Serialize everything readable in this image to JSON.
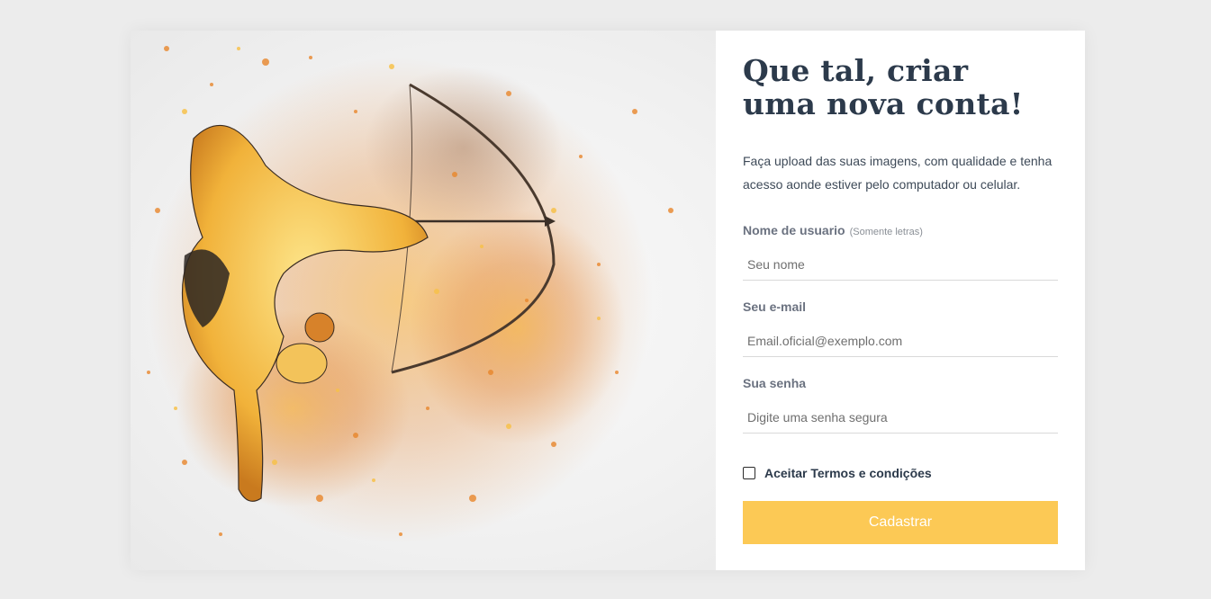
{
  "colors": {
    "page_background": "#ececec",
    "title": "#2c3a4b",
    "button_background": "#fcc955",
    "button_text": "#ffffff"
  },
  "illustration": {
    "subject": "watercolor archer girl drawing a bow"
  },
  "form": {
    "title": "Que tal, criar uma nova conta!",
    "description": "Faça upload das suas imagens, com qualidade e tenha acesso aonde estiver pelo computador ou celular.",
    "username": {
      "label": "Nome de usuario",
      "hint": "(Somente letras)",
      "placeholder": "Seu nome"
    },
    "email": {
      "label": "Seu e-mail",
      "placeholder": "Email.oficial@exemplo.com"
    },
    "password": {
      "label": "Sua senha",
      "placeholder": "Digite uma senha segura"
    },
    "terms": {
      "label": "Aceitar Termos e condições",
      "checked": false
    },
    "submit_label": "Cadastrar"
  }
}
